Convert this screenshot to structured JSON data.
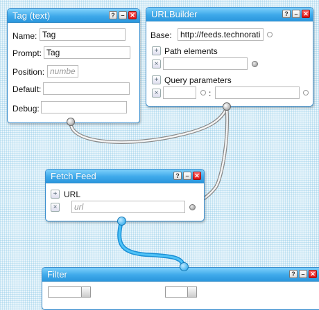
{
  "tag_module": {
    "title": "Tag (text)",
    "fields": [
      {
        "label": "Name:",
        "value": "Tag",
        "placeholder": ""
      },
      {
        "label": "Prompt:",
        "value": "Tag",
        "placeholder": ""
      },
      {
        "label": "Position:",
        "value": "",
        "placeholder": "number"
      },
      {
        "label": "Default:",
        "value": "",
        "placeholder": ""
      },
      {
        "label": "Debug:",
        "value": "",
        "placeholder": ""
      }
    ]
  },
  "urlbuilder_module": {
    "title": "URLBuilder",
    "base_label": "Base:",
    "base_value": "http://feeds.technorati",
    "path_label": "Path elements",
    "query_label": "Query parameters",
    "query_separator": ":"
  },
  "fetch_module": {
    "title": "Fetch Feed",
    "url_label": "URL",
    "url_placeholder": "url"
  },
  "filter_module": {
    "title": "Filter"
  },
  "titlebar_buttons": {
    "help": "?",
    "minimize": "–",
    "close": "✕"
  },
  "colors": {
    "titlebar": "#3ea9ea",
    "wire_gray": "#a8a8a8",
    "wire_blue": "#22a7ec",
    "close": "#dd1111"
  },
  "icons": [
    "help-icon",
    "minimize-icon",
    "close-icon",
    "add-icon",
    "remove-icon"
  ]
}
